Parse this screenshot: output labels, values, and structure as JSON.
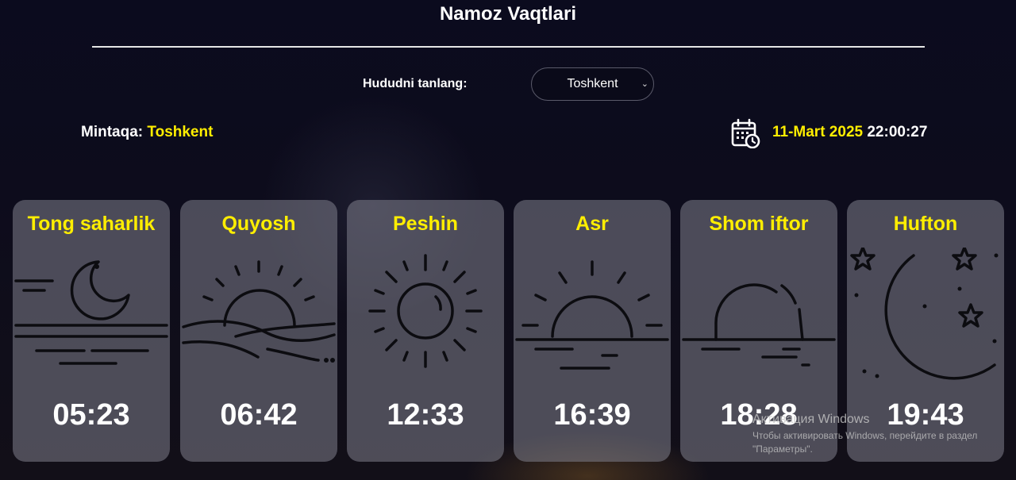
{
  "header": {
    "title": "Namoz Vaqtlari"
  },
  "region": {
    "label": "Hududni tanlang:",
    "selected": "Toshkent"
  },
  "info": {
    "mintaqa_label": "Mintaqa:",
    "mintaqa_value": "Toshkent",
    "date": "11-Mart 2025",
    "time": "22:00:27"
  },
  "prayers": [
    {
      "name": "Tong saharlik",
      "time": "05:23",
      "icon": "moon-setting-icon"
    },
    {
      "name": "Quyosh",
      "time": "06:42",
      "icon": "sunrise-icon"
    },
    {
      "name": "Peshin",
      "time": "12:33",
      "icon": "sun-icon"
    },
    {
      "name": "Asr",
      "time": "16:39",
      "icon": "half-sun-icon"
    },
    {
      "name": "Shom iftor",
      "time": "18:28",
      "icon": "sunset-icon"
    },
    {
      "name": "Hufton",
      "time": "19:43",
      "icon": "crescent-stars-icon"
    }
  ],
  "watermark": {
    "title": "Активация Windows",
    "line1": "Чтобы активировать Windows, перейдите в раздел",
    "line2": "\"Параметры\"."
  },
  "colors": {
    "accent": "#ffee00",
    "card": "#80808c",
    "background": "#0a0a1a"
  }
}
